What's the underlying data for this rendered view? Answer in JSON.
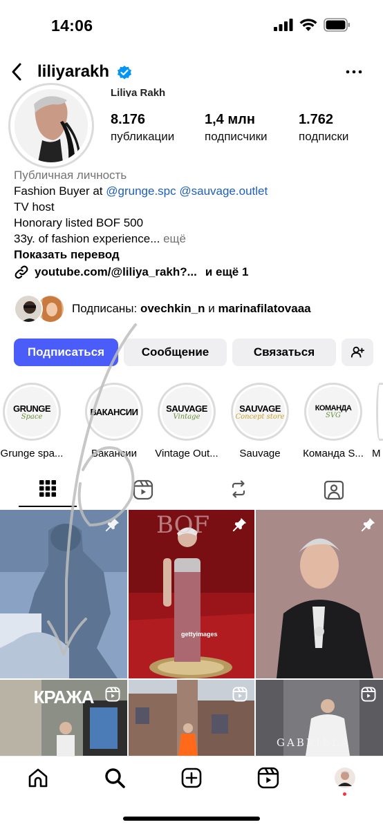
{
  "status_bar": {
    "time": "14:06"
  },
  "header": {
    "username": "liliyarakh"
  },
  "profile": {
    "full_name": "Liliya Rakh",
    "stats": [
      {
        "value": "8.176",
        "label": "публикации"
      },
      {
        "value": "1,4 млн",
        "label": "подписчики"
      },
      {
        "value": "1.762",
        "label": "подписки"
      }
    ]
  },
  "bio": {
    "category": "Публичная личность",
    "line1_prefix": "Fashion Buyer at ",
    "mention1": "@grunge.spc",
    "mention2": "@sauvage.outlet",
    "line2": "TV host",
    "line3": "Honorary listed BOF 500",
    "line4": "33y. of fashion experience...",
    "more": " ещё",
    "translate": "Показать перевод",
    "link": "youtube.com/@liliya_rakh?...",
    "link_more": "и ещё 1"
  },
  "followed_by": {
    "prefix": "Подписаны: ",
    "user1": "ovechkin_n",
    "conj": " и ",
    "user2": "marinafilatovaaa"
  },
  "actions": {
    "follow": "Подписаться",
    "message": "Сообщение",
    "contact": "Связаться"
  },
  "highlights": [
    {
      "title": "GRUNGE",
      "subtitle": "Space",
      "label": "Grunge spa..."
    },
    {
      "title": "ВАКАНСИИ",
      "subtitle": "",
      "label": "Вакансии"
    },
    {
      "title": "SAUVAGE",
      "subtitle": "Vintage",
      "label": "Vintage Out..."
    },
    {
      "title": "SAUVAGE",
      "subtitle": "Concept store",
      "label": "Sauvage"
    },
    {
      "title": "КОМАНДА",
      "subtitle": "SVG",
      "label": "Команда S..."
    },
    {
      "title": "",
      "subtitle": "",
      "label": "M"
    }
  ],
  "grid": {
    "caption_kraza": "КРАЖА",
    "bof_text": "BOF",
    "getty_text": "gettyimages",
    "gabriela_text": "GABRIELA"
  },
  "colors": {
    "accent": "#4a5df9",
    "link": "#1d5fb8",
    "secondary_text": "#737373",
    "notification_dot": "#ff3040"
  }
}
